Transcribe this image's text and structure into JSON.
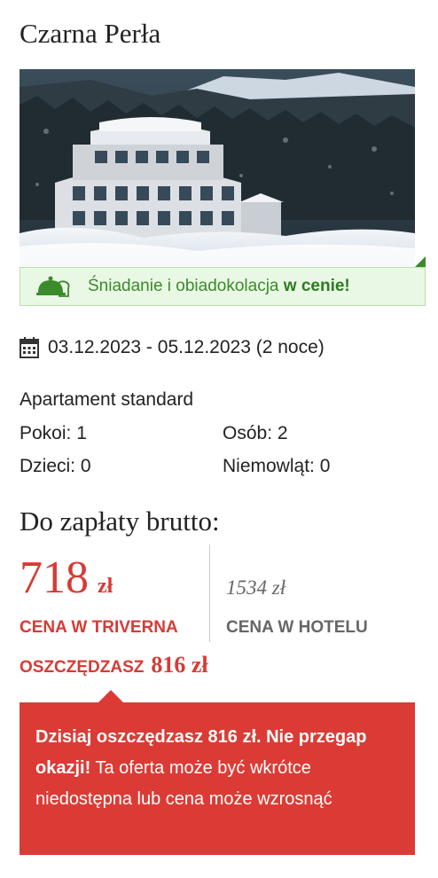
{
  "hotel": {
    "name": "Czarna Perła"
  },
  "banner": {
    "text": "Śniadanie i obiadokolacja",
    "highlight": "w cenie!",
    "icon": "meal-cloche-icon",
    "color": "#3b8a2c"
  },
  "stay": {
    "dates": "03.12.2023 - 05.12.2023 (2 noce)",
    "room_type": "Apartament standard",
    "details": [
      {
        "label": "Pokoi:",
        "value": "1"
      },
      {
        "label": "Osób:",
        "value": "2"
      },
      {
        "label": "Dzieci:",
        "value": "0"
      },
      {
        "label": "Niemowląt:",
        "value": "0"
      }
    ]
  },
  "summary": {
    "title": "Do zapłaty brutto:",
    "price_value": "718",
    "price_currency": "zł",
    "price_label": "CENA W TRIVERNA",
    "hotel_price": "1534 zł",
    "hotel_label": "CENA W HOTELU",
    "savings_label": "OSZCZĘDZASZ",
    "savings_amount": "816 zł",
    "accent_color": "#d63b36"
  },
  "promo": {
    "bold_text": "Dzisiaj oszczędzasz 816 zł. Nie przegap okazji!",
    "text": "Ta oferta może być wkrótce niedostępna lub cena może wzrosnąć",
    "background": "#dc3b35"
  }
}
